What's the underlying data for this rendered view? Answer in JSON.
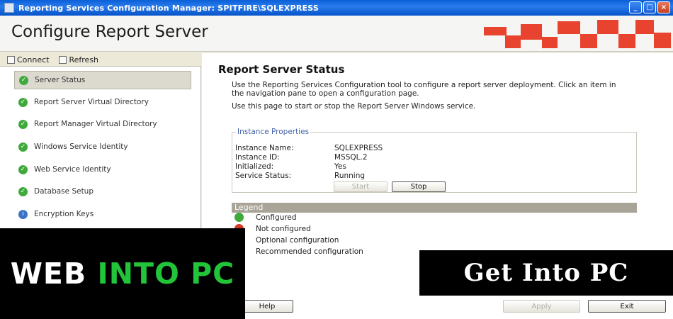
{
  "window": {
    "title": "Reporting Services Configuration Manager: SPITFIRE\\SQLEXPRESS",
    "controls": [
      "_",
      "□",
      "×"
    ]
  },
  "header": {
    "title": "Configure Report Server"
  },
  "toolbar": {
    "connect": "Connect",
    "refresh": "Refresh"
  },
  "nav": {
    "items": [
      {
        "label": "Server Status",
        "status": "configured"
      },
      {
        "label": "Report Server Virtual Directory",
        "status": "configured"
      },
      {
        "label": "Report Manager Virtual Directory",
        "status": "configured"
      },
      {
        "label": "Windows Service Identity",
        "status": "configured"
      },
      {
        "label": "Web Service Identity",
        "status": "configured"
      },
      {
        "label": "Database Setup",
        "status": "configured"
      },
      {
        "label": "Encryption Keys",
        "status": "info"
      }
    ]
  },
  "main": {
    "title": "Report Server Status",
    "description": "Use the Reporting Services Configuration tool to configure a report server deployment. Click an item in the navigation pane to open a configuration page.",
    "description2": "Use this page to start or stop the Report Server Windows service.",
    "instance": {
      "legend": "Instance Properties",
      "rows": [
        {
          "label": "Instance Name:",
          "value": "SQLEXPRESS"
        },
        {
          "label": "Instance ID:",
          "value": "MSSQL.2"
        },
        {
          "label": "Initialized:",
          "value": "Yes"
        },
        {
          "label": "Service Status:",
          "value": "Running"
        }
      ],
      "start_label": "Start",
      "stop_label": "Stop"
    },
    "legend": {
      "title": "Legend",
      "items": [
        "Configured",
        "Not configured",
        "Optional configuration",
        "Recommended configuration"
      ]
    }
  },
  "footer": {
    "help": "Help",
    "apply": "Apply",
    "exit": "Exit"
  },
  "watermarks": {
    "left_part1": "WEB",
    "left_part2": "INTO PC",
    "right": "Get Into PC"
  },
  "colors": {
    "accent": "#e8432f",
    "title_bar": "#0a5fd8",
    "configured": "#3fa93c",
    "watermark_green": "#22c53a"
  }
}
